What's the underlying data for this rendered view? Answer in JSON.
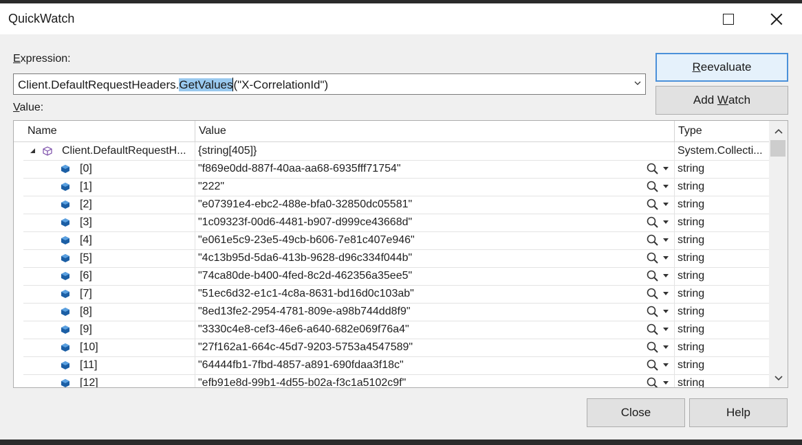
{
  "window": {
    "title": "QuickWatch"
  },
  "expression": {
    "label_pre": "",
    "label_accel": "E",
    "label_post": "xpression:",
    "text_before": "Client.DefaultRequestHeaders.",
    "text_selected": "GetValues",
    "text_after": "(\"X-CorrelationId\")"
  },
  "value_label": {
    "accel": "V",
    "rest": "alue:"
  },
  "buttons": {
    "reevaluate_accel": "R",
    "reevaluate_rest": "eevaluate",
    "addwatch_pre": "Add ",
    "addwatch_accel": "W",
    "addwatch_post": "atch",
    "close": "Close",
    "help": "Help"
  },
  "grid": {
    "columns": [
      "Name",
      "Value",
      "Type"
    ],
    "root": {
      "name": "Client.DefaultRequestH...",
      "value": "{string[405]}",
      "type": "System.Collecti..."
    },
    "rows": [
      {
        "name": "[0]",
        "value": "\"f869e0dd-887f-40aa-aa68-6935fff71754\"",
        "type": "string"
      },
      {
        "name": "[1]",
        "value": "\"222\"",
        "type": "string"
      },
      {
        "name": "[2]",
        "value": "\"e07391e4-ebc2-488e-bfa0-32850dc05581\"",
        "type": "string"
      },
      {
        "name": "[3]",
        "value": "\"1c09323f-00d6-4481-b907-d999ce43668d\"",
        "type": "string"
      },
      {
        "name": "[4]",
        "value": "\"e061e5c9-23e5-49cb-b606-7e81c407e946\"",
        "type": "string"
      },
      {
        "name": "[5]",
        "value": "\"4c13b95d-5da6-413b-9628-d96c334f044b\"",
        "type": "string"
      },
      {
        "name": "[6]",
        "value": "\"74ca80de-b400-4fed-8c2d-462356a35ee5\"",
        "type": "string"
      },
      {
        "name": "[7]",
        "value": "\"51ec6d32-e1c1-4c8a-8631-bd16d0c103ab\"",
        "type": "string"
      },
      {
        "name": "[8]",
        "value": "\"8ed13fe2-2954-4781-809e-a98b744dd8f9\"",
        "type": "string"
      },
      {
        "name": "[9]",
        "value": "\"3330c4e8-cef3-46e6-a640-682e069f76a4\"",
        "type": "string"
      },
      {
        "name": "[10]",
        "value": "\"27f162a1-664c-45d7-9203-5753a4547589\"",
        "type": "string"
      },
      {
        "name": "[11]",
        "value": "\"64444fb1-7fbd-4857-a891-690fdaa3f18c\"",
        "type": "string"
      },
      {
        "name": "[12]",
        "value": "\"efb91e8d-99b1-4d55-b02a-f3c1a5102c9f\"",
        "type": "string"
      }
    ]
  },
  "icons": {
    "field": "field-cube-icon",
    "root": "object-icon",
    "expander": "collapse-triangle-icon",
    "magnifier": "magnifier-icon",
    "dropdown": "chevron-down-icon"
  },
  "colors": {
    "selection": "#99c9ef",
    "field_icon": "#1c5fa5",
    "default_button_border": "#4a90d9"
  }
}
